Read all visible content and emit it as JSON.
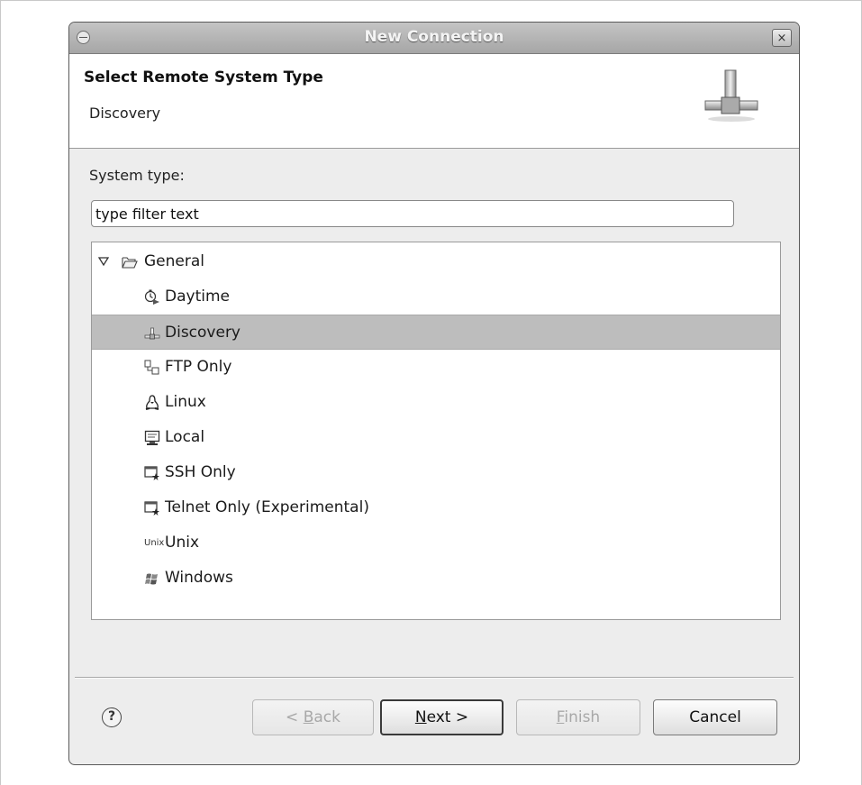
{
  "window": {
    "title": "New Connection",
    "close_glyph": "×"
  },
  "banner": {
    "title": "Select Remote System Type",
    "description": "Discovery",
    "icon": "discovery-connector-icon"
  },
  "filter": {
    "label": "System type:",
    "value": "type filter text"
  },
  "tree": {
    "root": {
      "label": "General",
      "icon": "folder-open-icon",
      "expanded": true
    },
    "items": [
      {
        "label": "Daytime",
        "icon": "daytime-icon"
      },
      {
        "label": "Discovery",
        "icon": "discovery-icon",
        "selected": true
      },
      {
        "label": "FTP Only",
        "icon": "ftp-icon"
      },
      {
        "label": "Linux",
        "icon": "linux-icon"
      },
      {
        "label": "Local",
        "icon": "local-icon"
      },
      {
        "label": "SSH Only",
        "icon": "ssh-icon"
      },
      {
        "label": "Telnet Only (Experimental)",
        "icon": "telnet-icon"
      },
      {
        "label": "Unix",
        "icon": "unix-icon",
        "icon_text": "Unix"
      },
      {
        "label": "Windows",
        "icon": "windows-icon"
      }
    ]
  },
  "buttons": {
    "help_glyph": "?",
    "back": {
      "mnemonic": "B",
      "rest": "ack",
      "prefix": "< "
    },
    "next": {
      "mnemonic": "N",
      "rest": "ext >"
    },
    "finish": {
      "mnemonic": "F",
      "rest": "inish"
    },
    "cancel": "Cancel"
  }
}
